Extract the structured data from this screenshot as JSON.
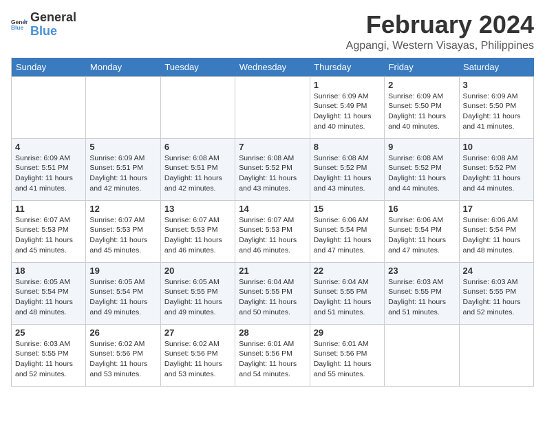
{
  "logo": {
    "text_general": "General",
    "text_blue": "Blue"
  },
  "title": "February 2024",
  "location": "Agpangi, Western Visayas, Philippines",
  "days_of_week": [
    "Sunday",
    "Monday",
    "Tuesday",
    "Wednesday",
    "Thursday",
    "Friday",
    "Saturday"
  ],
  "weeks": [
    [
      {
        "day": "",
        "info": ""
      },
      {
        "day": "",
        "info": ""
      },
      {
        "day": "",
        "info": ""
      },
      {
        "day": "",
        "info": ""
      },
      {
        "day": "1",
        "info": "Sunrise: 6:09 AM\nSunset: 5:49 PM\nDaylight: 11 hours and 40 minutes."
      },
      {
        "day": "2",
        "info": "Sunrise: 6:09 AM\nSunset: 5:50 PM\nDaylight: 11 hours and 40 minutes."
      },
      {
        "day": "3",
        "info": "Sunrise: 6:09 AM\nSunset: 5:50 PM\nDaylight: 11 hours and 41 minutes."
      }
    ],
    [
      {
        "day": "4",
        "info": "Sunrise: 6:09 AM\nSunset: 5:51 PM\nDaylight: 11 hours and 41 minutes."
      },
      {
        "day": "5",
        "info": "Sunrise: 6:09 AM\nSunset: 5:51 PM\nDaylight: 11 hours and 42 minutes."
      },
      {
        "day": "6",
        "info": "Sunrise: 6:08 AM\nSunset: 5:51 PM\nDaylight: 11 hours and 42 minutes."
      },
      {
        "day": "7",
        "info": "Sunrise: 6:08 AM\nSunset: 5:52 PM\nDaylight: 11 hours and 43 minutes."
      },
      {
        "day": "8",
        "info": "Sunrise: 6:08 AM\nSunset: 5:52 PM\nDaylight: 11 hours and 43 minutes."
      },
      {
        "day": "9",
        "info": "Sunrise: 6:08 AM\nSunset: 5:52 PM\nDaylight: 11 hours and 44 minutes."
      },
      {
        "day": "10",
        "info": "Sunrise: 6:08 AM\nSunset: 5:52 PM\nDaylight: 11 hours and 44 minutes."
      }
    ],
    [
      {
        "day": "11",
        "info": "Sunrise: 6:07 AM\nSunset: 5:53 PM\nDaylight: 11 hours and 45 minutes."
      },
      {
        "day": "12",
        "info": "Sunrise: 6:07 AM\nSunset: 5:53 PM\nDaylight: 11 hours and 45 minutes."
      },
      {
        "day": "13",
        "info": "Sunrise: 6:07 AM\nSunset: 5:53 PM\nDaylight: 11 hours and 46 minutes."
      },
      {
        "day": "14",
        "info": "Sunrise: 6:07 AM\nSunset: 5:53 PM\nDaylight: 11 hours and 46 minutes."
      },
      {
        "day": "15",
        "info": "Sunrise: 6:06 AM\nSunset: 5:54 PM\nDaylight: 11 hours and 47 minutes."
      },
      {
        "day": "16",
        "info": "Sunrise: 6:06 AM\nSunset: 5:54 PM\nDaylight: 11 hours and 47 minutes."
      },
      {
        "day": "17",
        "info": "Sunrise: 6:06 AM\nSunset: 5:54 PM\nDaylight: 11 hours and 48 minutes."
      }
    ],
    [
      {
        "day": "18",
        "info": "Sunrise: 6:05 AM\nSunset: 5:54 PM\nDaylight: 11 hours and 48 minutes."
      },
      {
        "day": "19",
        "info": "Sunrise: 6:05 AM\nSunset: 5:54 PM\nDaylight: 11 hours and 49 minutes."
      },
      {
        "day": "20",
        "info": "Sunrise: 6:05 AM\nSunset: 5:55 PM\nDaylight: 11 hours and 49 minutes."
      },
      {
        "day": "21",
        "info": "Sunrise: 6:04 AM\nSunset: 5:55 PM\nDaylight: 11 hours and 50 minutes."
      },
      {
        "day": "22",
        "info": "Sunrise: 6:04 AM\nSunset: 5:55 PM\nDaylight: 11 hours and 51 minutes."
      },
      {
        "day": "23",
        "info": "Sunrise: 6:03 AM\nSunset: 5:55 PM\nDaylight: 11 hours and 51 minutes."
      },
      {
        "day": "24",
        "info": "Sunrise: 6:03 AM\nSunset: 5:55 PM\nDaylight: 11 hours and 52 minutes."
      }
    ],
    [
      {
        "day": "25",
        "info": "Sunrise: 6:03 AM\nSunset: 5:55 PM\nDaylight: 11 hours and 52 minutes."
      },
      {
        "day": "26",
        "info": "Sunrise: 6:02 AM\nSunset: 5:56 PM\nDaylight: 11 hours and 53 minutes."
      },
      {
        "day": "27",
        "info": "Sunrise: 6:02 AM\nSunset: 5:56 PM\nDaylight: 11 hours and 53 minutes."
      },
      {
        "day": "28",
        "info": "Sunrise: 6:01 AM\nSunset: 5:56 PM\nDaylight: 11 hours and 54 minutes."
      },
      {
        "day": "29",
        "info": "Sunrise: 6:01 AM\nSunset: 5:56 PM\nDaylight: 11 hours and 55 minutes."
      },
      {
        "day": "",
        "info": ""
      },
      {
        "day": "",
        "info": ""
      }
    ]
  ]
}
